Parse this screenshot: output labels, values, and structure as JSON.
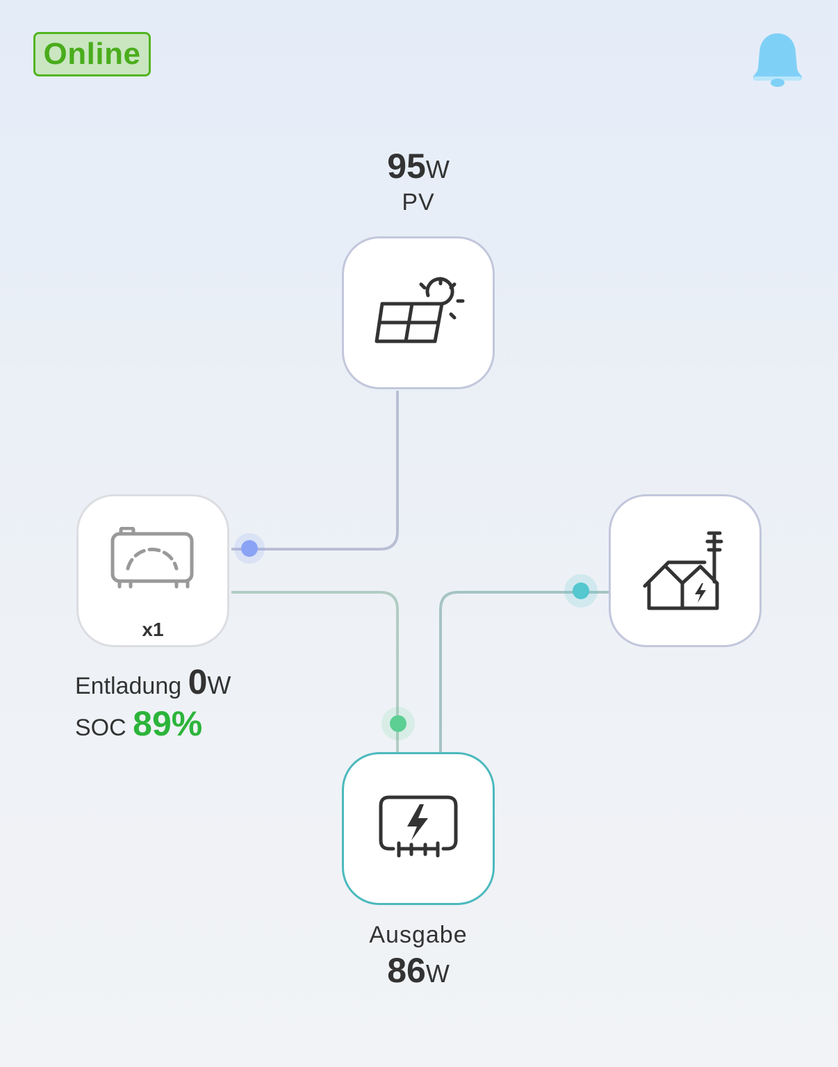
{
  "status": {
    "label": "Online",
    "color": "#4aac1c"
  },
  "header": {
    "notification_icon": "bell-icon",
    "bell_color": "#7fd0f7"
  },
  "pv": {
    "value": "95",
    "unit": "W",
    "label": "PV",
    "icon": "solar-panel-sun-icon"
  },
  "battery": {
    "count": "x1",
    "mode_label": "Entladung",
    "power_value": "0",
    "power_unit": "W",
    "soc_label": "SOC",
    "soc_value": "89%",
    "soc_level": 0.89,
    "icon": "battery-pack-icon"
  },
  "grid": {
    "icon": "house-grid-icon"
  },
  "output": {
    "label": "Ausgabe",
    "value": "86",
    "unit": "W",
    "icon": "output-socket-icon"
  },
  "colors": {
    "pv_line": "#b8bfd4",
    "pv_dot": "#8aa3f5",
    "battery_line": "#b2ccc3",
    "battery_dot": "#5ccf93",
    "grid_line": "#a6c3c4",
    "grid_dot": "#54c7cf",
    "soc_green": "#2cb43a",
    "output_border": "#4cb9bd"
  }
}
